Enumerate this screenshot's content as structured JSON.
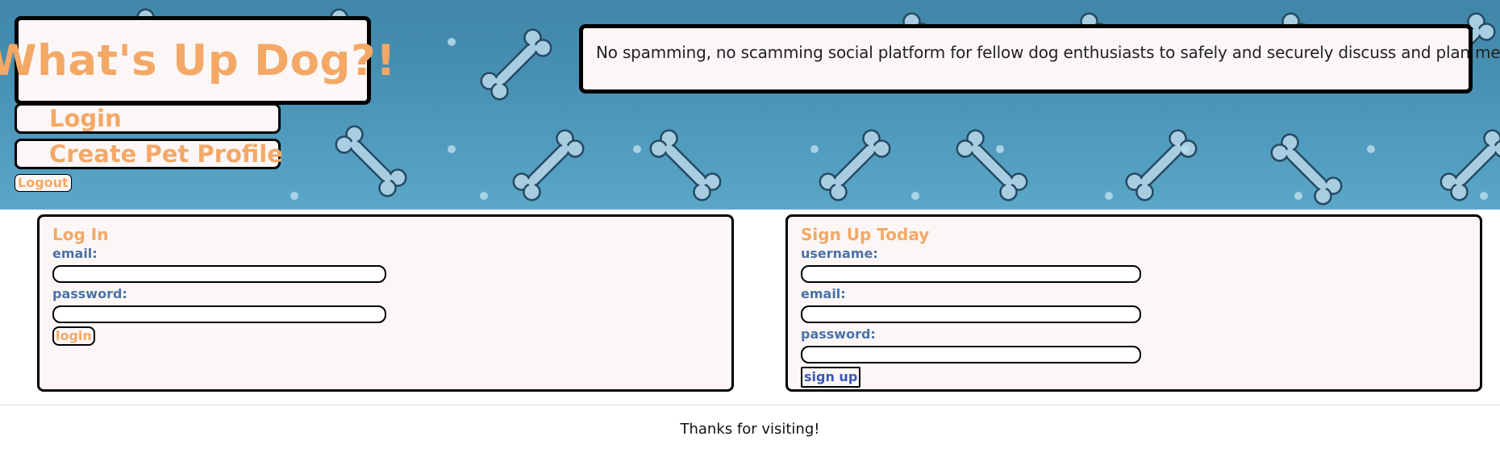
{
  "header": {
    "title": "What's Up Dog?!",
    "tagline": "No spamming, no scamming social platform for fellow dog enthusiasts to safely and securely discuss and plan meetups!",
    "nav": {
      "login_label": "Login",
      "create_profile_label": "Create Pet Profile",
      "logout_label": "Logout"
    },
    "background_pattern": "bone-icon"
  },
  "login_form": {
    "heading": "Log In",
    "email_label": "email:",
    "email_value": "",
    "password_label": "password:",
    "password_value": "",
    "submit_label": "login"
  },
  "signup_form": {
    "heading": "Sign Up Today",
    "username_label": "username:",
    "username_value": "",
    "email_label": "email:",
    "email_value": "",
    "password_label": "password:",
    "password_value": "",
    "submit_label": "sign up"
  },
  "footer": {
    "text": "Thanks for visiting!"
  },
  "colors": {
    "accent_orange": "#f4a866",
    "label_blue": "#4a72a6",
    "banner_blue": "#4a93b6",
    "panel_bg": "#fcf7f6"
  }
}
